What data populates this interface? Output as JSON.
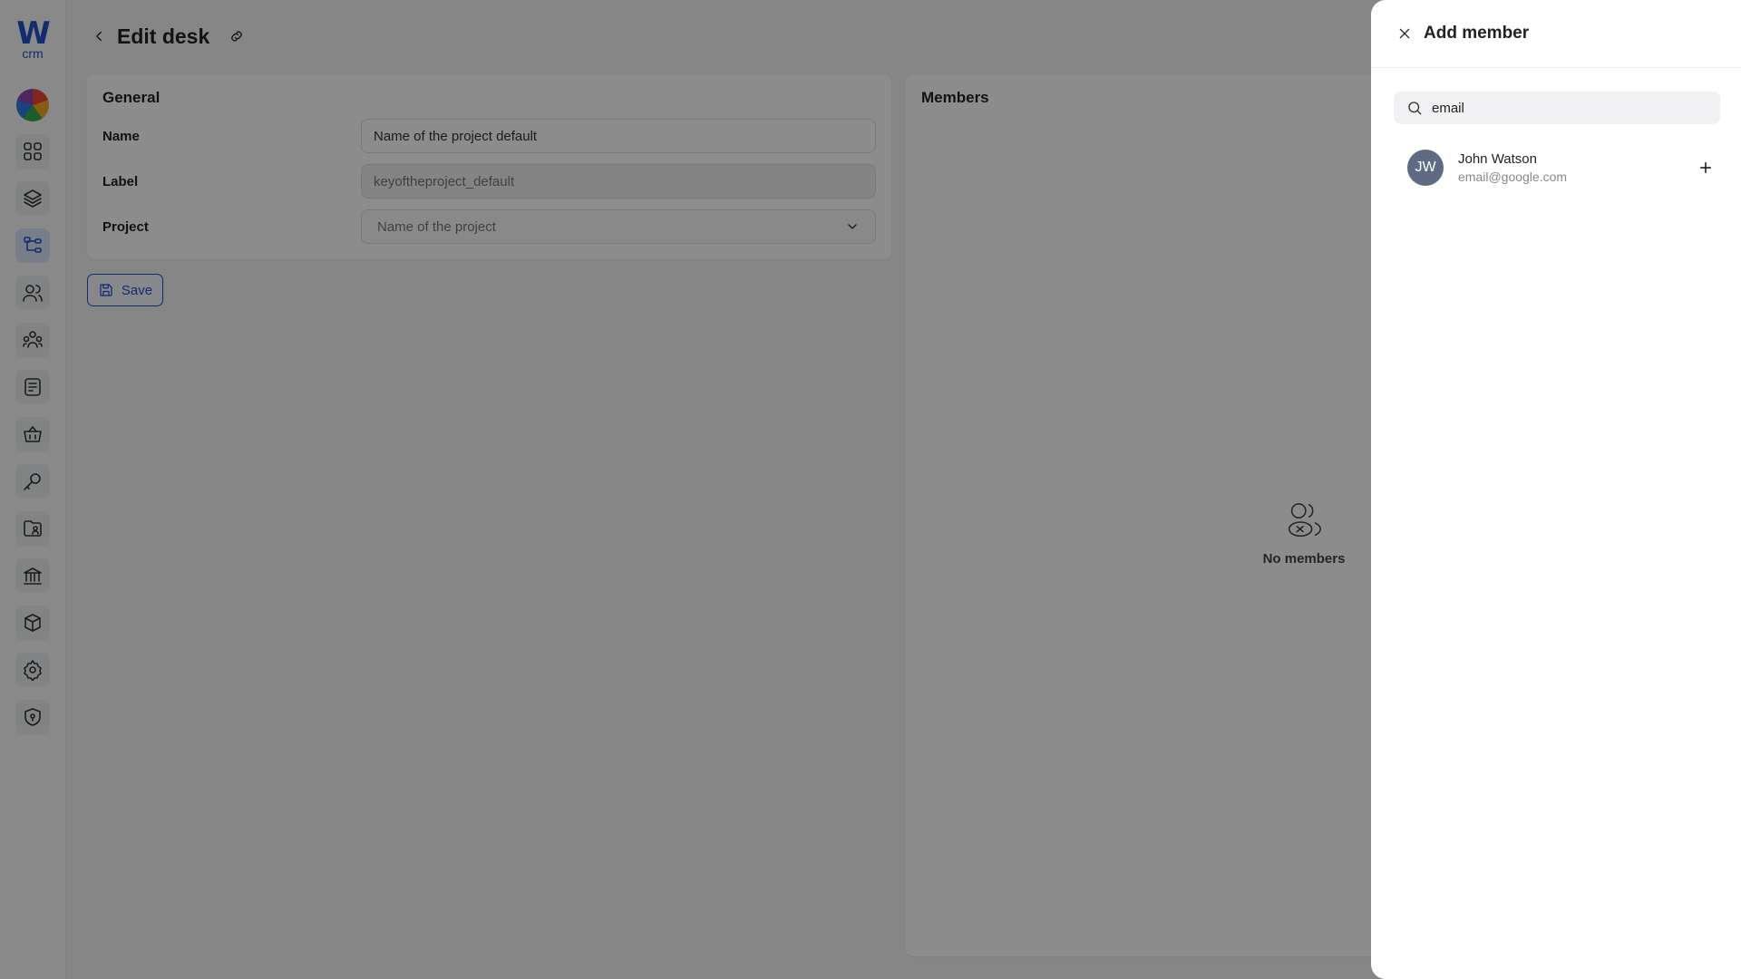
{
  "logo": {
    "mark": "W",
    "text": "crm"
  },
  "sidebar": {
    "items": [
      {
        "icon": "dashboard-grid-icon"
      },
      {
        "icon": "layers-icon"
      },
      {
        "icon": "hierarchy-icon",
        "active": true
      },
      {
        "icon": "users-icon"
      },
      {
        "icon": "team-icon"
      },
      {
        "icon": "notes-icon"
      },
      {
        "icon": "basket-icon"
      },
      {
        "icon": "key-icon"
      },
      {
        "icon": "folder-user-icon"
      },
      {
        "icon": "bank-icon"
      },
      {
        "icon": "box-icon"
      },
      {
        "icon": "gear-icon"
      },
      {
        "icon": "shield-icon"
      }
    ]
  },
  "header": {
    "title": "Edit desk"
  },
  "general": {
    "title": "General",
    "fields": {
      "name": {
        "label": "Name",
        "value": "Name of the project default"
      },
      "label": {
        "label": "Label",
        "value": "keyoftheproject_default"
      },
      "project": {
        "label": "Project",
        "placeholder": "Name of the project"
      }
    }
  },
  "save_label": "Save",
  "members": {
    "title": "Members",
    "empty_text": "No members"
  },
  "drawer": {
    "title": "Add member",
    "search": {
      "value": "email"
    },
    "results": [
      {
        "initials": "JW",
        "name": "John Watson",
        "email": "email@google.com"
      }
    ]
  },
  "colors": {
    "accent": "#2550c7",
    "avatar": "#5f6b82"
  }
}
